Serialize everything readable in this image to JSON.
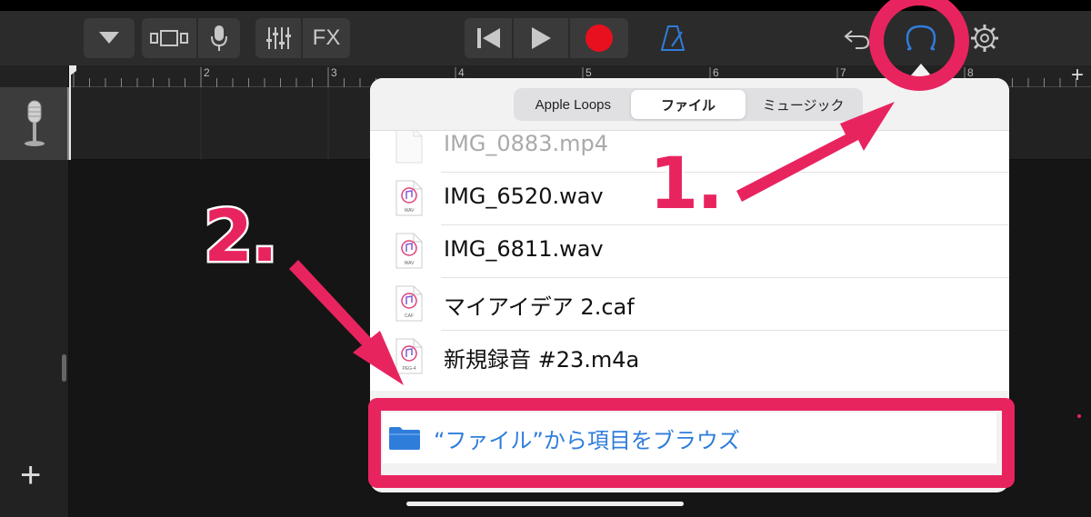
{
  "toolbar": {
    "fx_label": "FX",
    "icons": [
      "browser-dropdown-icon",
      "view-toggle-icon",
      "microphone-icon",
      "mixer-sliders-icon",
      "skip-back-icon",
      "play-icon",
      "record-icon",
      "metronome-icon",
      "undo-icon",
      "loop-browser-icon",
      "settings-gear-icon"
    ],
    "accent_color": "#2f7ddb",
    "record_color": "#e8101e"
  },
  "ruler": {
    "bar_numbers": [
      "2",
      "3",
      "4",
      "5",
      "6",
      "7",
      "8"
    ],
    "add_section_label": "+"
  },
  "tracks": {
    "add_track_label": "+",
    "track_icon": "microphone-track-icon"
  },
  "browser": {
    "tabs": [
      {
        "label": "Apple Loops",
        "active": false
      },
      {
        "label": "ファイル",
        "active": true
      },
      {
        "label": "ミュージック",
        "active": false
      }
    ],
    "files": [
      {
        "name": "IMG_0883.mp4",
        "icon": "blank-file-icon",
        "badge": "",
        "faded": true
      },
      {
        "name": "IMG_6520.wav",
        "icon": "audio-file-icon",
        "badge": "WAV",
        "faded": false
      },
      {
        "name": "IMG_6811.wav",
        "icon": "audio-file-icon",
        "badge": "WAV",
        "faded": false
      },
      {
        "name": "マイアイデア 2.caf",
        "icon": "audio-file-icon",
        "badge": "CAF",
        "faded": false
      },
      {
        "name": "新規録音 #23.m4a",
        "icon": "audio-file-icon",
        "badge": "PEG-4",
        "faded": false
      }
    ],
    "browse_label": "“ファイル”から項目をブラウズ",
    "browse_icon": "folder-icon"
  },
  "annotations": {
    "step1": "1.",
    "step2": "2.",
    "color": "#e8245f"
  }
}
